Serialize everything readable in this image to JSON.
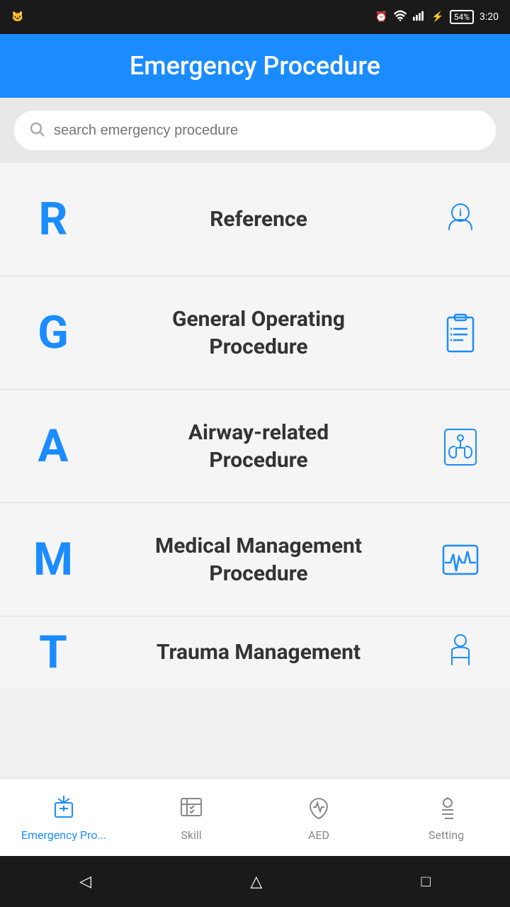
{
  "status_bar": {
    "time": "3:20",
    "battery": "54%",
    "icons": [
      "alarm",
      "wifi",
      "signal",
      "battery"
    ]
  },
  "app_bar": {
    "title": "Emergency Procedure"
  },
  "search": {
    "placeholder": "search emergency procedure"
  },
  "menu_items": [
    {
      "letter": "R",
      "label": "Reference",
      "icon": "info-hand"
    },
    {
      "letter": "G",
      "label": "General Operating\nProcedure",
      "icon": "clipboard"
    },
    {
      "letter": "A",
      "label": "Airway-related\nProcedure",
      "icon": "lungs"
    },
    {
      "letter": "M",
      "label": "Medical Management\nProcedure",
      "icon": "ecg"
    },
    {
      "letter": "T",
      "label": "Trauma Management",
      "icon": "trauma"
    }
  ],
  "bottom_nav": [
    {
      "id": "emergency",
      "label": "Emergency Pro...",
      "active": true
    },
    {
      "id": "skill",
      "label": "Skill",
      "active": false
    },
    {
      "id": "aed",
      "label": "AED",
      "active": false
    },
    {
      "id": "setting",
      "label": "Setting",
      "active": false
    }
  ],
  "android_nav": {
    "back": "◁",
    "home": "△",
    "recents": "□"
  }
}
